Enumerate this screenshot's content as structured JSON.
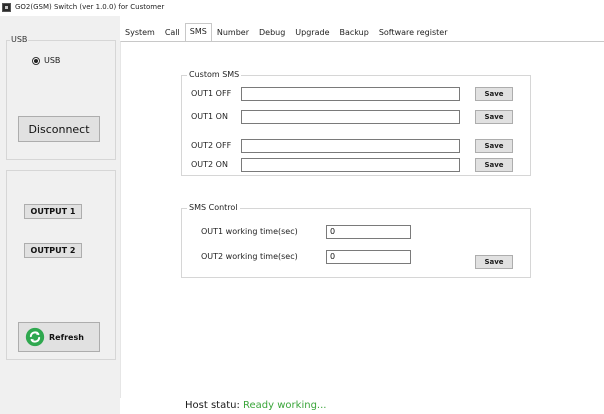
{
  "window": {
    "title": "GO2(GSM) Switch (ver 1.0.0) for Customer",
    "icon": "app-icon"
  },
  "sidebar": {
    "usb_group_label": "USB",
    "usb_radio_label": "USB",
    "disconnect_label": "Disconnect",
    "output1_label": "OUTPUT 1",
    "output2_label": "OUTPUT 2",
    "refresh_label": "Refresh",
    "refresh_icon": "refresh-icon"
  },
  "tabs": [
    {
      "label": "System",
      "active": false
    },
    {
      "label": "Call",
      "active": false
    },
    {
      "label": "SMS",
      "active": true
    },
    {
      "label": "Number",
      "active": false
    },
    {
      "label": "Debug",
      "active": false
    },
    {
      "label": "Upgrade",
      "active": false
    },
    {
      "label": "Backup",
      "active": false
    },
    {
      "label": "Software register",
      "active": false
    }
  ],
  "custom_sms": {
    "title": "Custom SMS",
    "rows": [
      {
        "label": "OUT1 OFF",
        "value": "",
        "save": "Save"
      },
      {
        "label": "OUT1 ON",
        "value": "",
        "save": "Save"
      },
      {
        "label": "OUT2 OFF",
        "value": "",
        "save": "Save"
      },
      {
        "label": "OUT2 ON",
        "value": "",
        "save": "Save"
      }
    ]
  },
  "sms_control": {
    "title": "SMS Control",
    "out1_label": "OUT1 working time(sec)",
    "out1_value": "0",
    "out2_label": "OUT2 working time(sec)",
    "out2_value": "0",
    "save": "Save"
  },
  "status": {
    "label": "Host statu:",
    "value": "Ready working...",
    "value_color": "#3aa53a"
  }
}
